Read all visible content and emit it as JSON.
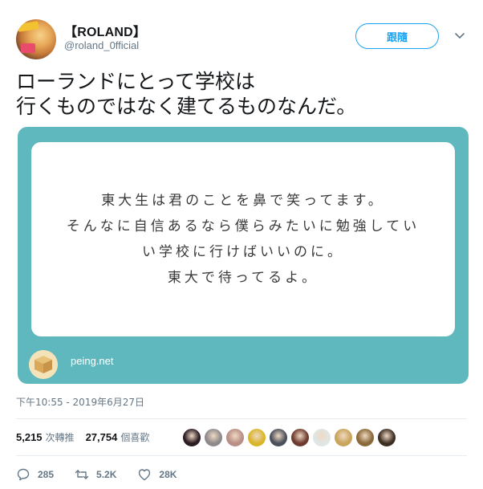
{
  "header": {
    "display_name": "【ROLAND】",
    "handle": "@roland_0fficial",
    "follow_label": "跟隨"
  },
  "tweet": {
    "text": "ローランドにとって学校は\n行くものではなく建てるものなんだ。"
  },
  "card": {
    "question_text": "東大生は君のことを鼻で笑ってます。\nそんなに自信あるなら僕らみたいに勉強してい\nい学校に行けばいいのに。\n東大で待ってるよ。",
    "domain": "peing.net",
    "background_color": "#5fb8bd"
  },
  "timestamp": "下午10:55 - 2019年6月27日",
  "stats": {
    "retweets_count": "5,215",
    "retweets_label": "次轉推",
    "likes_count": "27,754",
    "likes_label": "個喜歡"
  },
  "liker_avatars": [
    {
      "color": "#2b1b22"
    },
    {
      "color": "#8e8a8c"
    },
    {
      "color": "#b88f86"
    },
    {
      "color": "#d9b52a"
    },
    {
      "color": "#4a4f5a"
    },
    {
      "color": "#6e3a2f"
    },
    {
      "color": "#dfe6e4"
    },
    {
      "color": "#c9a45a"
    },
    {
      "color": "#8a6a3a"
    },
    {
      "color": "#3d2e22"
    }
  ],
  "actions": {
    "reply_count": "285",
    "retweet_count": "5.2K",
    "like_count": "28K"
  },
  "colors": {
    "accent": "#1da1f2",
    "secondary_text": "#657786"
  }
}
